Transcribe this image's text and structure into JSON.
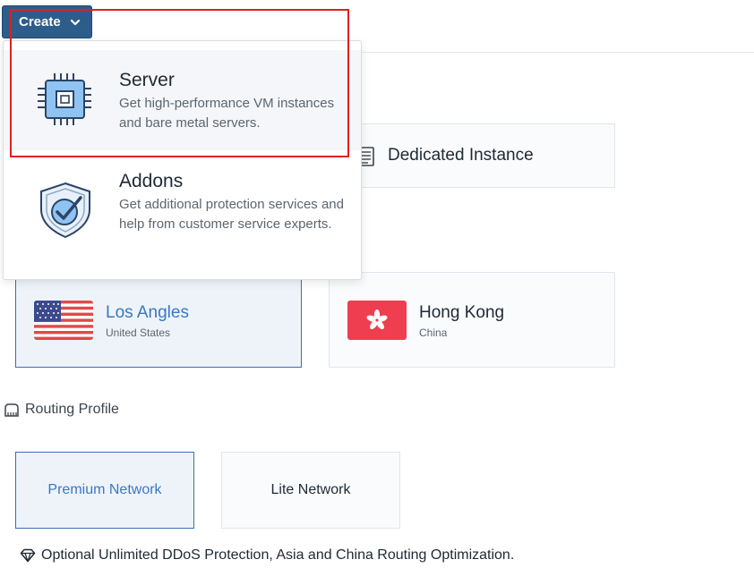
{
  "create_button": {
    "label": "Create"
  },
  "create_menu": {
    "items": [
      {
        "title": "Server",
        "description": "Get high-performance VM instances and bare metal servers.",
        "icon": "cpu-chip-icon"
      },
      {
        "title": "Addons",
        "description": "Get additional protection services and help from customer service experts.",
        "icon": "shield-check-icon"
      }
    ]
  },
  "server_types": {
    "dedicated_instance": {
      "label": "Dedicated Instance",
      "icon": "document-icon"
    }
  },
  "locations": [
    {
      "city": "Los Angles",
      "country": "United States",
      "icon": "us-flag-icon",
      "selected": true
    },
    {
      "city": "Hong Kong",
      "country": "China",
      "icon": "hk-flag-icon",
      "selected": false
    }
  ],
  "routing": {
    "heading": "Routing Profile",
    "options": [
      {
        "label": "Premium Network",
        "selected": true
      },
      {
        "label": "Lite Network",
        "selected": false
      }
    ],
    "note": "Optional Unlimited DDoS Protection, Asia and China Routing Optimization."
  },
  "colors": {
    "primary": "#2d5d8b",
    "link_blue": "#3a78c3",
    "highlight_red": "#e02020",
    "hk_red": "#ef3e4f"
  }
}
